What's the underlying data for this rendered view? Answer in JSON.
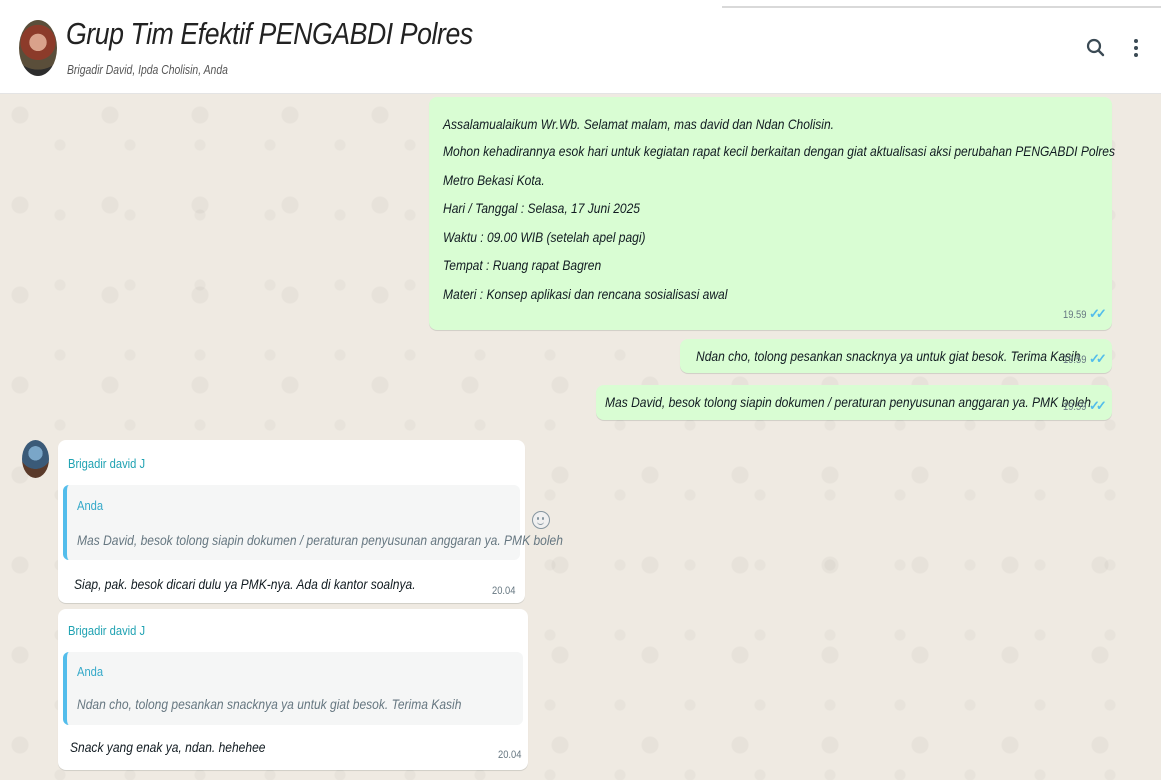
{
  "header": {
    "group_name": "Grup Tim Efektif PENGABDI Polres",
    "members": "Brigadir David, Ipda Cholisin, Anda",
    "icons": [
      "search-icon",
      "menu-icon"
    ]
  },
  "messages": {
    "out1": {
      "lines": [
        "Assalamualaikum Wr.Wb. Selamat malam, mas david dan Ndan Cholisin.",
        "Mohon kehadirannya esok hari untuk kegiatan rapat kecil berkaitan dengan giat aktualisasi aksi perubahan PENGABDI Polres",
        "Metro Bekasi Kota.",
        "Hari / Tanggal   : Selasa, 17 Juni 2025",
        "Waktu   : 09.00 WIB (setelah apel pagi)",
        "Tempat  : Ruang rapat Bagren",
        "Materi  : Konsep aplikasi dan rencana sosialisasi awal"
      ],
      "time": "19.59",
      "status": "read"
    },
    "out2": {
      "text": "Ndan cho, tolong pesankan snacknya ya untuk giat besok. Terima Kasih",
      "time": "19.59",
      "status": "read"
    },
    "out3": {
      "text": "Mas David, besok tolong siapin dokumen / peraturan penyusunan anggaran ya. PMK boleh",
      "time": "19.59",
      "status": "read"
    },
    "in1": {
      "sender": "Brigadir david J",
      "quote_author": "Anda",
      "quote_text": "Mas David, besok tolong siapin dokumen / peraturan penyusunan anggaran ya. PMK boleh",
      "text": "Siap, pak. besok dicari dulu ya PMK-nya. Ada di kantor soalnya.",
      "time": "20.04"
    },
    "in2": {
      "sender": "Brigadir david J",
      "quote_author": "Anda",
      "quote_text": "Ndan cho, tolong pesankan snacknya ya untuk giat besok. Terima Kasih",
      "text": "Snack yang enak ya, ndan. hehehee",
      "time": "20.04"
    }
  },
  "colors": {
    "outgoing_bubble": "#d9fdd3",
    "incoming_bubble": "#ffffff",
    "sender_name": "#1fa2b2",
    "read_ticks": "#53bdeb",
    "chat_background": "#efeae2"
  }
}
